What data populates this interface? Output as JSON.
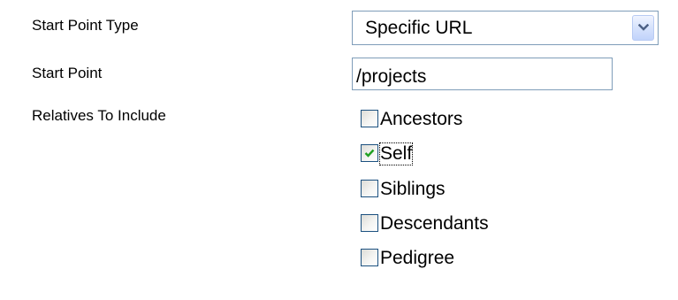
{
  "form": {
    "start_point_type": {
      "label": "Start Point Type",
      "selected": "Specific URL"
    },
    "start_point": {
      "label": "Start Point",
      "value": "/projects"
    },
    "relatives": {
      "label": "Relatives To Include",
      "options": [
        {
          "label": "Ancestors",
          "checked": false
        },
        {
          "label": "Self",
          "checked": true
        },
        {
          "label": "Siblings",
          "checked": false
        },
        {
          "label": "Descendants",
          "checked": false
        },
        {
          "label": "Pedigree",
          "checked": false
        }
      ]
    }
  },
  "colors": {
    "field_border": "#7f9db9",
    "checkbox_border": "#1c5180",
    "checkmark": "#21a121",
    "dropdown_arrow": "#4d6185"
  },
  "icons": {
    "dropdown": "chevron-down-icon",
    "check": "checkmark-icon"
  }
}
